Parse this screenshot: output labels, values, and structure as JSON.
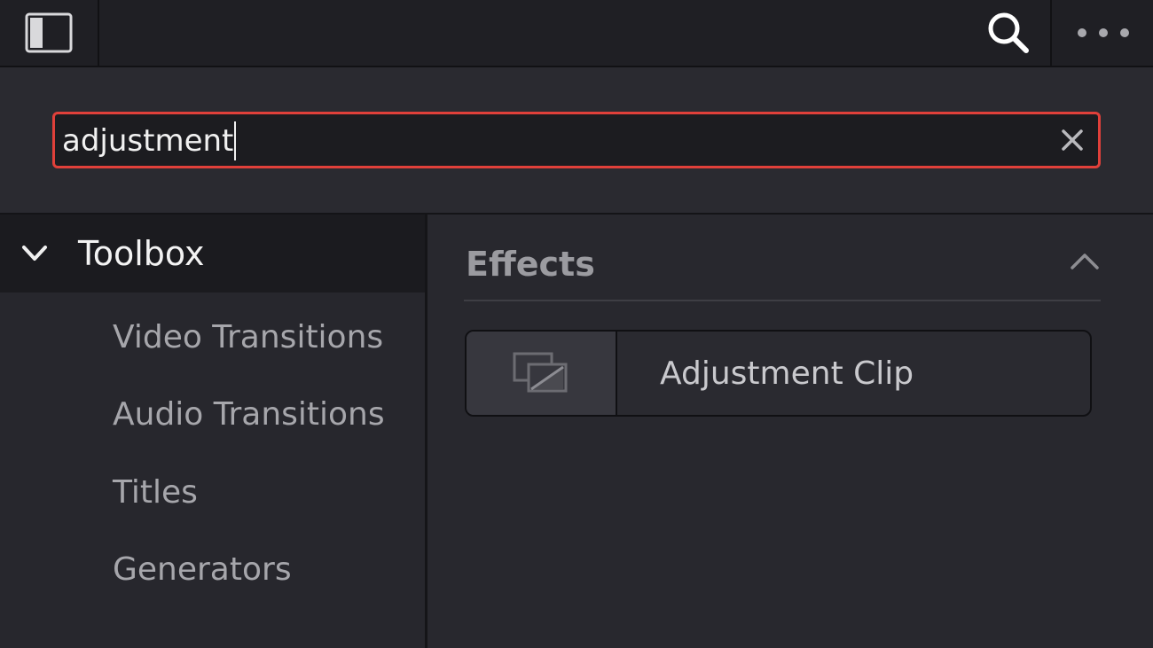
{
  "topbar": {
    "sidebar_toggle_icon": "sidebar-toggle-icon",
    "search_icon": "search-icon",
    "more_icon": "more-horizontal-icon"
  },
  "search": {
    "value": "adjustment",
    "clear_icon": "close-icon",
    "border_color": "#e0403a"
  },
  "left_panel": {
    "toolbox_label": "Toolbox",
    "toolbox_expanded": true,
    "items": [
      {
        "label": "Video Transitions"
      },
      {
        "label": "Audio Transitions"
      },
      {
        "label": "Titles"
      },
      {
        "label": "Generators"
      }
    ]
  },
  "right_panel": {
    "section_title": "Effects",
    "collapse_icon": "chevron-up-icon",
    "results": [
      {
        "label": "Adjustment Clip",
        "icon": "adjustment-clip-icon"
      }
    ]
  }
}
